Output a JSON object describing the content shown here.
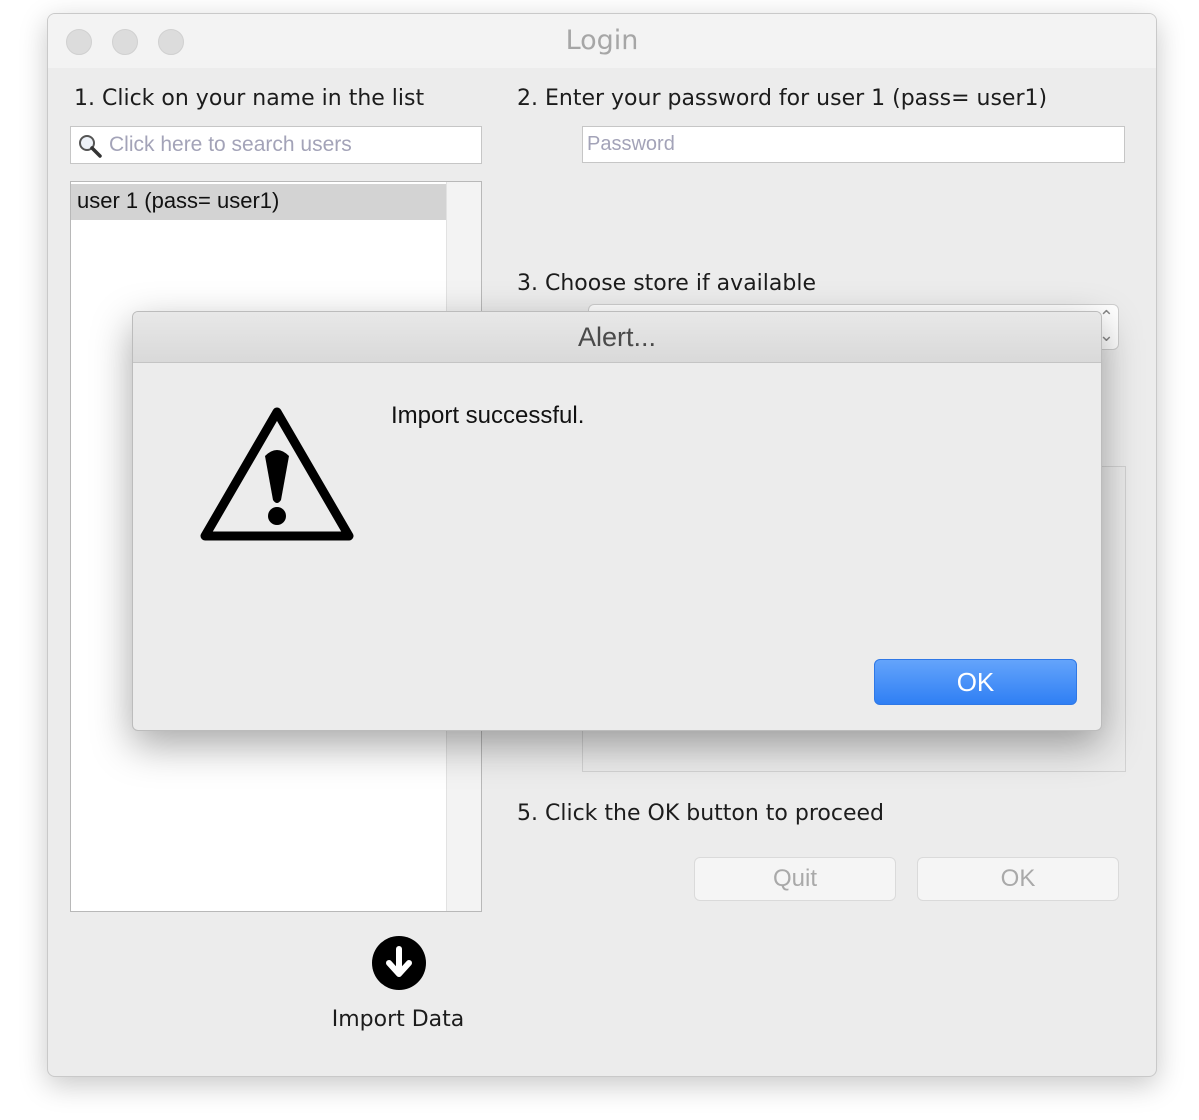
{
  "window": {
    "title": "Login"
  },
  "steps": {
    "step1": "1. Click on your name in the list",
    "step2": "2. Enter your password for user 1 (pass= user1)",
    "step3": "3. Choose store if available",
    "step5": "5. Click the OK button to proceed"
  },
  "search": {
    "placeholder": "Click here to search users",
    "icon": "search-icon"
  },
  "user_list": {
    "items": [
      {
        "label": "user 1 (pass= user1)",
        "selected": true
      }
    ]
  },
  "password": {
    "placeholder": "Password"
  },
  "buttons": {
    "quit": "Quit",
    "ok": "OK"
  },
  "import": {
    "label": "Import Data",
    "icon": "download-arrow-icon"
  },
  "alert": {
    "title": "Alert...",
    "message": "Import successful.",
    "ok_label": "OK",
    "icon": "warning-triangle-icon"
  },
  "colors": {
    "window_bg": "#ececec",
    "accent_blue": "#2f7ff4",
    "selected_row": "#d3d3d3",
    "disabled_text": "#a9a9a9"
  }
}
